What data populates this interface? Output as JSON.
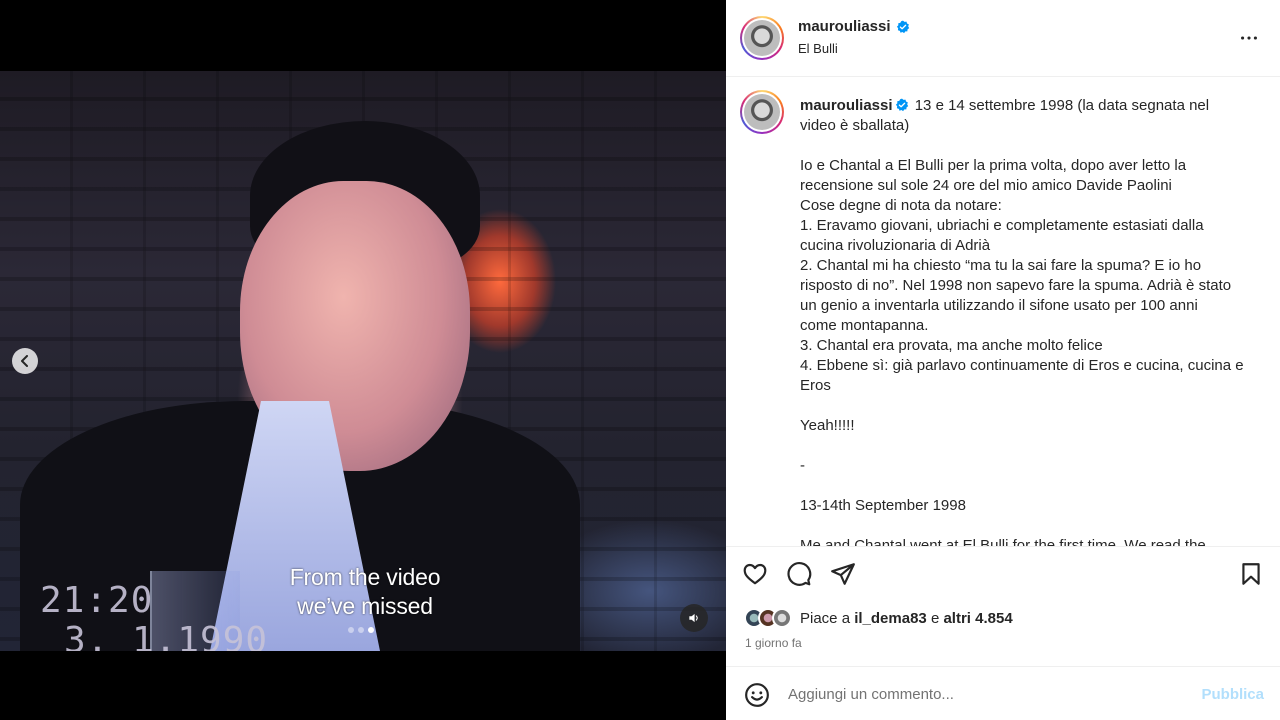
{
  "post": {
    "username": "maurouliassi",
    "location": "El Bulli",
    "caption_lines": [
      "13 e 14 settembre 1998 (la data segnata nel",
      "video è sballata)",
      "",
      "Io e Chantal a El Bulli per la prima volta, dopo aver letto la",
      "recensione sul sole 24 ore del mio amico Davide Paolini",
      "Cose degne di nota da notare:",
      "1. Eravamo giovani, ubriachi e completamente estasiati dalla",
      "cucina rivoluzionaria di Adrià",
      "2. Chantal mi ha chiesto “ma tu la sai fare la spuma? E io ho",
      "risposto di no”. Nel 1998 non sapevo fare la spuma. Adrià è stato",
      "un genio a inventarla utilizzando il sifone usato per 100 anni",
      "come montapanna.",
      "3. Chantal era provata, ma anche molto felice",
      "4. Ebbene sì: già parlavo continuamente di Eros e cucina, cucina e",
      "Eros",
      "",
      "Yeah!!!!!",
      "",
      "-",
      "",
      "13-14th September 1998",
      "",
      "Me and Chantal went at El Bulli for the first time. We read the"
    ],
    "likes_prefix": "Piace a",
    "likes_user": "il_dema83",
    "likes_conjunction": "e",
    "likes_others": "altri 4.854",
    "time_ago": "1 giorno fa"
  },
  "media": {
    "subtitle_line1": "From the video",
    "subtitle_line2": "we’ve missed",
    "timestamp_time": "21:20",
    "timestamp_date": "3. 1.1990",
    "slide_count": 3,
    "active_slide": 3
  },
  "comment": {
    "placeholder": "Aggiungi un commento...",
    "publish_label": "Pubblica"
  },
  "icons": {
    "more": "more-horizontal-icon",
    "verified": "verified-badge-icon",
    "like": "heart-icon",
    "comment": "comment-bubble-icon",
    "share": "paper-plane-icon",
    "save": "bookmark-icon",
    "emoji": "smiley-icon",
    "prev": "chevron-left-icon",
    "audio": "speaker-muted-icon"
  },
  "colors": {
    "verified": "#0095f6",
    "publish_disabled": "#b2dffc",
    "secondary_text": "#737373"
  }
}
